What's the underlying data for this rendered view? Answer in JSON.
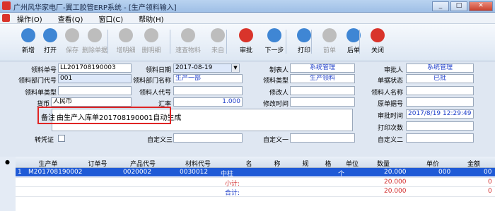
{
  "window": {
    "title": "广州风华家电厂-翼工胶管ERP系统 - [生产领料输入]",
    "controls": [
      "_",
      "□",
      "✕"
    ]
  },
  "menu": [
    "操作(O)",
    "查看(Q)",
    "窗口(C)",
    "帮助(H)"
  ],
  "toolbar": [
    {
      "label": "新增",
      "icon": "new-icon",
      "color": "#3f86d4",
      "enabled": true
    },
    {
      "label": "打开",
      "icon": "open-folder-icon",
      "color": "#3f86d4",
      "enabled": true
    },
    {
      "label": "保存",
      "icon": "save-icon",
      "color": "#bdbdbd",
      "enabled": false
    },
    {
      "label": "删除单据",
      "icon": "delete-icon",
      "color": "#bdbdbd",
      "enabled": false
    },
    {
      "label": "增明细",
      "icon": "add-detail-icon",
      "color": "#bdbdbd",
      "enabled": false
    },
    {
      "label": "删明细",
      "icon": "cut-detail-icon",
      "color": "#bdbdbd",
      "enabled": false
    },
    {
      "label": "速查物料",
      "icon": "search-material-icon",
      "color": "#bdbdbd",
      "enabled": false
    },
    {
      "label": "来自",
      "icon": "from-icon",
      "color": "#bdbdbd",
      "enabled": false
    },
    {
      "label": "审批",
      "icon": "approve-icon",
      "color": "#d9342b",
      "enabled": true
    },
    {
      "label": "下一步",
      "icon": "next-step-icon",
      "color": "#3f86d4",
      "enabled": true
    },
    {
      "label": "打印",
      "icon": "print-icon",
      "color": "#3f86d4",
      "enabled": true
    },
    {
      "label": "前单",
      "icon": "prev-record-icon",
      "color": "#bdbdbd",
      "enabled": false
    },
    {
      "label": "后单",
      "icon": "next-record-icon",
      "color": "#3f86d4",
      "enabled": true
    },
    {
      "label": "关闭",
      "icon": "close-door-icon",
      "color": "#d9342b",
      "enabled": true
    }
  ],
  "form": {
    "order_no_label": "领料单号",
    "order_no": "LL201708190003",
    "date_label": "领料日期",
    "date": "2017-08-19",
    "maker_label": "制表人",
    "maker": "系统管理",
    "approver_label": "审批人",
    "approver": "系统管理",
    "dept_code_label": "领料部门代号",
    "dept_code": "001",
    "dept_name_label": "领料部门名称",
    "dept_name": "生产一部",
    "type_label": "领料类型",
    "type": "生产领料",
    "status_label": "单据状态",
    "status": "已批",
    "category_label": "领料单类型",
    "category": "",
    "person_code_label": "领料人代号",
    "person_code": "",
    "modifier_label": "修改人",
    "modifier": "",
    "person_name_label": "领料人名称",
    "person_name": "",
    "currency_label": "货币",
    "currency": "人民币",
    "rate_label": "汇率",
    "rate": "1.000",
    "modify_time_label": "修改时间",
    "modify_time": "",
    "original_no_label": "原单据号",
    "original_no": "",
    "remark_label": "备注",
    "remark": "由生产入库单201708190001自动生成",
    "approve_time_label": "审批时间",
    "approve_time": "2017/8/19 12:29:49",
    "print_count_label": "打印次数",
    "print_count": "",
    "voucher_label": "转凭证",
    "custom3_label": "自定义三",
    "custom3": "",
    "custom1_label": "自定义一",
    "custom1": "",
    "custom2_label": "自定义二",
    "custom2": ""
  },
  "grid": {
    "columns": [
      "生产单",
      "订单号",
      "产品代号",
      "材料代号",
      "名",
      "称",
      "规",
      "格",
      "单位",
      "数量",
      "单价",
      "金额"
    ],
    "rows": [
      {
        "no": "1",
        "production": "M201708190002",
        "order": "",
        "product": "0020002",
        "material": "0030012",
        "name": "中柱",
        "spec": "",
        "unit": "个",
        "qty": "20.000",
        "price": "000",
        "amount": "00"
      }
    ],
    "subtotal_label": "小计:",
    "subtotal_qty": "20.000",
    "subtotal_amount": "0",
    "total_label": "合计:",
    "total_qty": "20.000",
    "total_amount": "0",
    "row_indicator": "●"
  }
}
